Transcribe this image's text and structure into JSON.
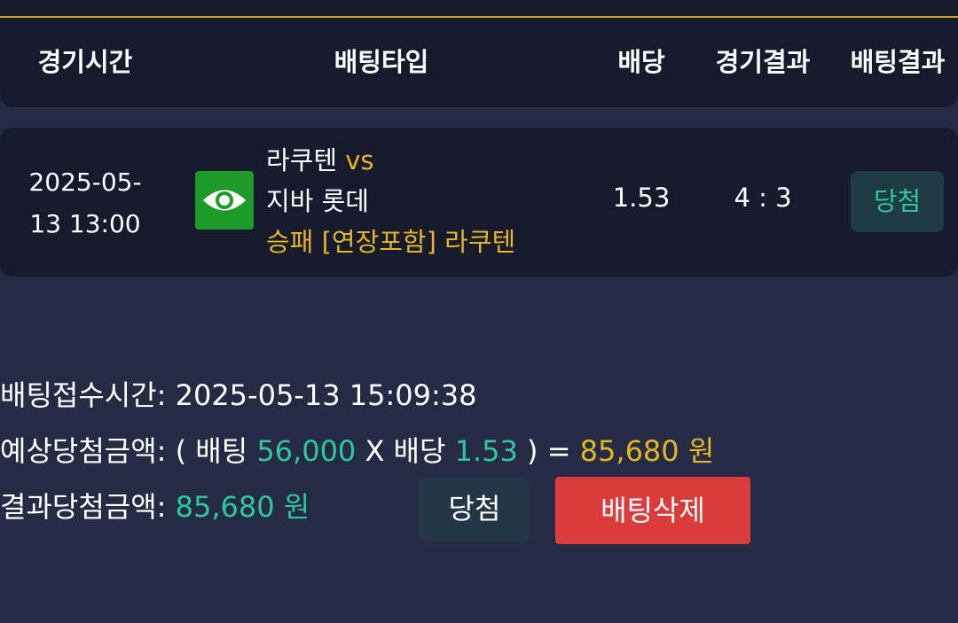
{
  "header": {
    "col_time": "경기시간",
    "col_bet_type": "배팅타입",
    "col_odds": "배당",
    "col_game_result": "경기결과",
    "col_bet_result": "배팅결과"
  },
  "bet": {
    "time_line1": "2025-05-",
    "time_line2": "13 13:00",
    "home_team": "라쿠텐",
    "vs": "vs",
    "away_team": "지바 롯데",
    "bet_type": "승패 [연장포함] 라쿠텐",
    "odds": "1.53",
    "score": "4 : 3",
    "result": "당첨",
    "view_icon": "eye-icon"
  },
  "summary": {
    "received_label": "배팅접수시간:",
    "received_value": "2025-05-13 15:09:38",
    "expected_label": "예상당첨금액:",
    "expected_open": "( 배팅",
    "expected_stake": "56,000",
    "expected_x": "X 배당",
    "expected_odds": "1.53",
    "expected_close": ") =",
    "expected_amount": "85,680 원",
    "result_label": "결과당첨금액:",
    "result_amount": "85,680 원",
    "win_button": "당첨",
    "delete_button": "배팅삭제"
  },
  "colors": {
    "background": "#252b45",
    "card": "#151a2d",
    "accent_yellow": "#e5b522",
    "accent_green": "#2ec79c",
    "delete_red": "#d93c3a",
    "eye_button_green": "#1e9a2a"
  }
}
